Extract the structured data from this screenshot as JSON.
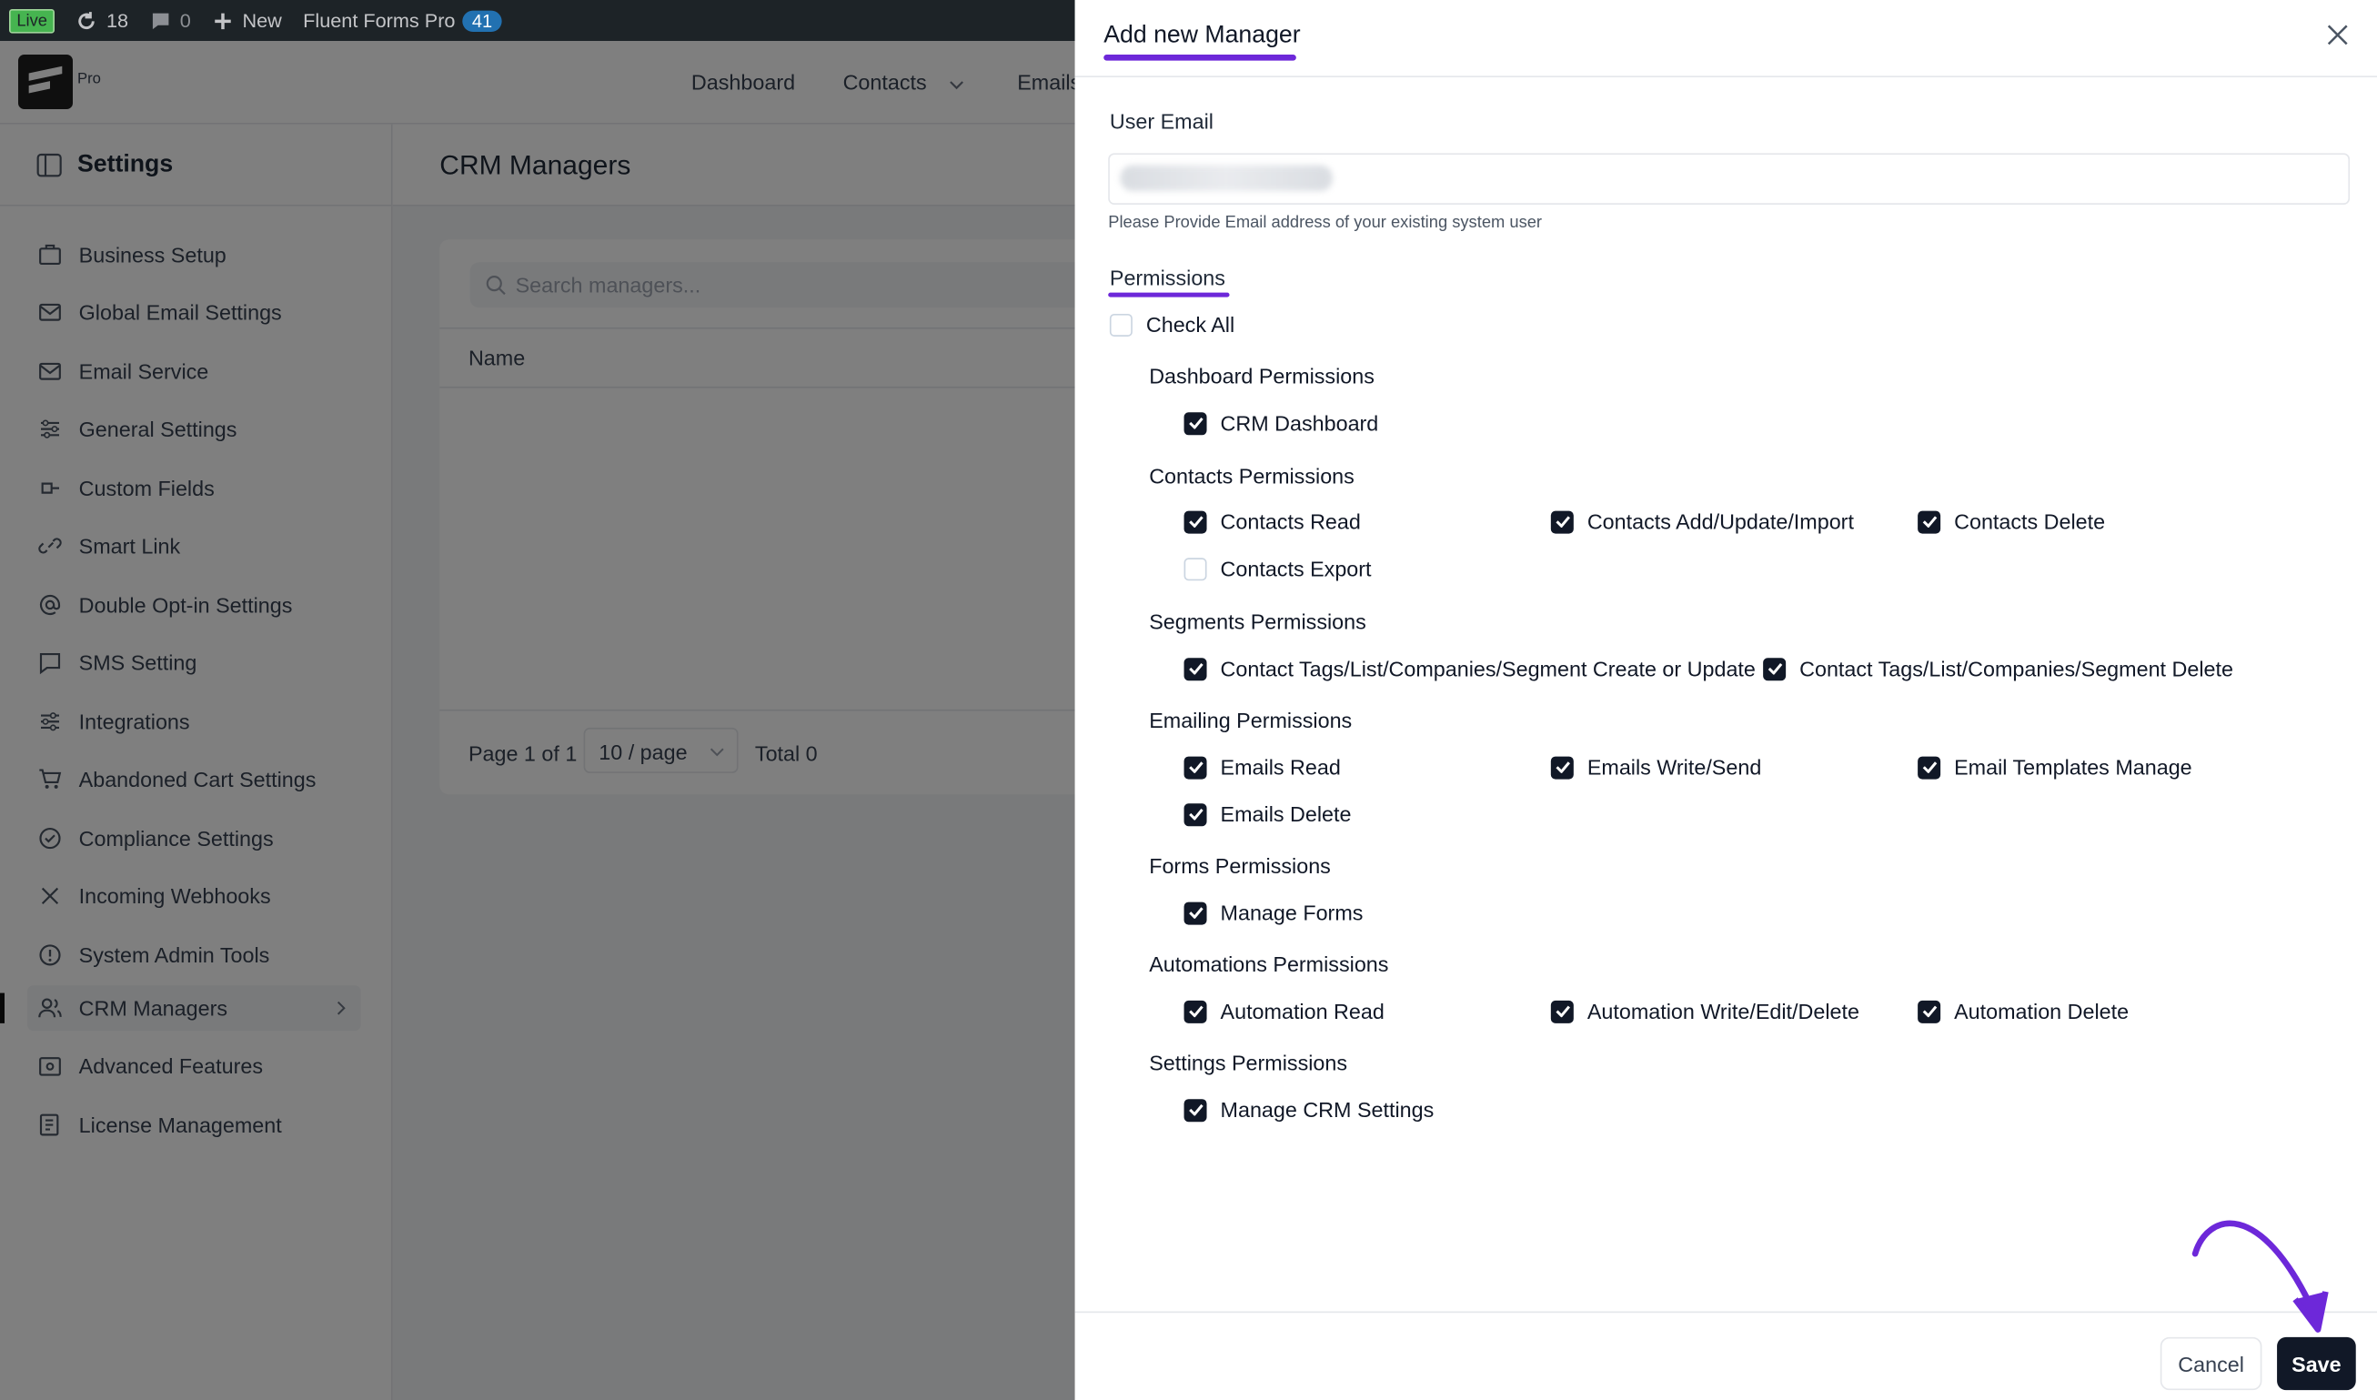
{
  "admin_bar": {
    "live": "Live",
    "updates": "18",
    "comments": "0",
    "new": "New",
    "plugin": "Fluent Forms Pro",
    "plugin_count": "41"
  },
  "logo_label": "Pro",
  "top_nav": [
    "Dashboard",
    "Contacts",
    "Emails"
  ],
  "settings": {
    "title": "Settings",
    "items": [
      "Business Setup",
      "Global Email Settings",
      "Email Service",
      "General Settings",
      "Custom Fields",
      "Smart Link",
      "Double Opt-in Settings",
      "SMS Setting",
      "Integrations",
      "Abandoned Cart Settings",
      "Compliance Settings",
      "Incoming Webhooks",
      "System Admin Tools",
      "CRM Managers",
      "Advanced Features",
      "License Management"
    ],
    "active": "CRM Managers"
  },
  "main": {
    "title": "CRM Managers",
    "search_placeholder": "Search managers...",
    "column_name": "Name",
    "page_info": "Page 1 of 1",
    "per_page": "10 / page",
    "total": "Total 0"
  },
  "drawer": {
    "title": "Add new Manager",
    "email_label": "User Email",
    "email_value": "",
    "email_help": "Please Provide Email address of your existing system user",
    "permissions_label": "Permissions",
    "check_all": "Check All",
    "groups": [
      {
        "title": "Dashboard Permissions",
        "items": [
          {
            "label": "CRM Dashboard",
            "checked": true
          }
        ]
      },
      {
        "title": "Contacts Permissions",
        "items": [
          {
            "label": "Contacts Read",
            "checked": true
          },
          {
            "label": "Contacts Add/Update/Import",
            "checked": true
          },
          {
            "label": "Contacts Delete",
            "checked": true
          },
          {
            "label": "Contacts Export",
            "checked": false
          }
        ]
      },
      {
        "title": "Segments Permissions",
        "items": [
          {
            "label": "Contact Tags/List/Companies/Segment Create or Update",
            "checked": true
          },
          {
            "label": "Contact Tags/List/Companies/Segment Delete",
            "checked": true
          }
        ]
      },
      {
        "title": "Emailing Permissions",
        "items": [
          {
            "label": "Emails Read",
            "checked": true
          },
          {
            "label": "Emails Write/Send",
            "checked": true
          },
          {
            "label": "Email Templates Manage",
            "checked": true
          },
          {
            "label": "Emails Delete",
            "checked": true
          }
        ]
      },
      {
        "title": "Forms Permissions",
        "items": [
          {
            "label": "Manage Forms",
            "checked": true
          }
        ]
      },
      {
        "title": "Automations Permissions",
        "items": [
          {
            "label": "Automation Read",
            "checked": true
          },
          {
            "label": "Automation Write/Edit/Delete",
            "checked": true
          },
          {
            "label": "Automation Delete",
            "checked": true
          }
        ]
      },
      {
        "title": "Settings Permissions",
        "items": [
          {
            "label": "Manage CRM Settings",
            "checked": true
          }
        ]
      }
    ],
    "cancel": "Cancel",
    "save": "Save"
  },
  "colors": {
    "accent": "#6d28d9",
    "dark": "#111827"
  }
}
